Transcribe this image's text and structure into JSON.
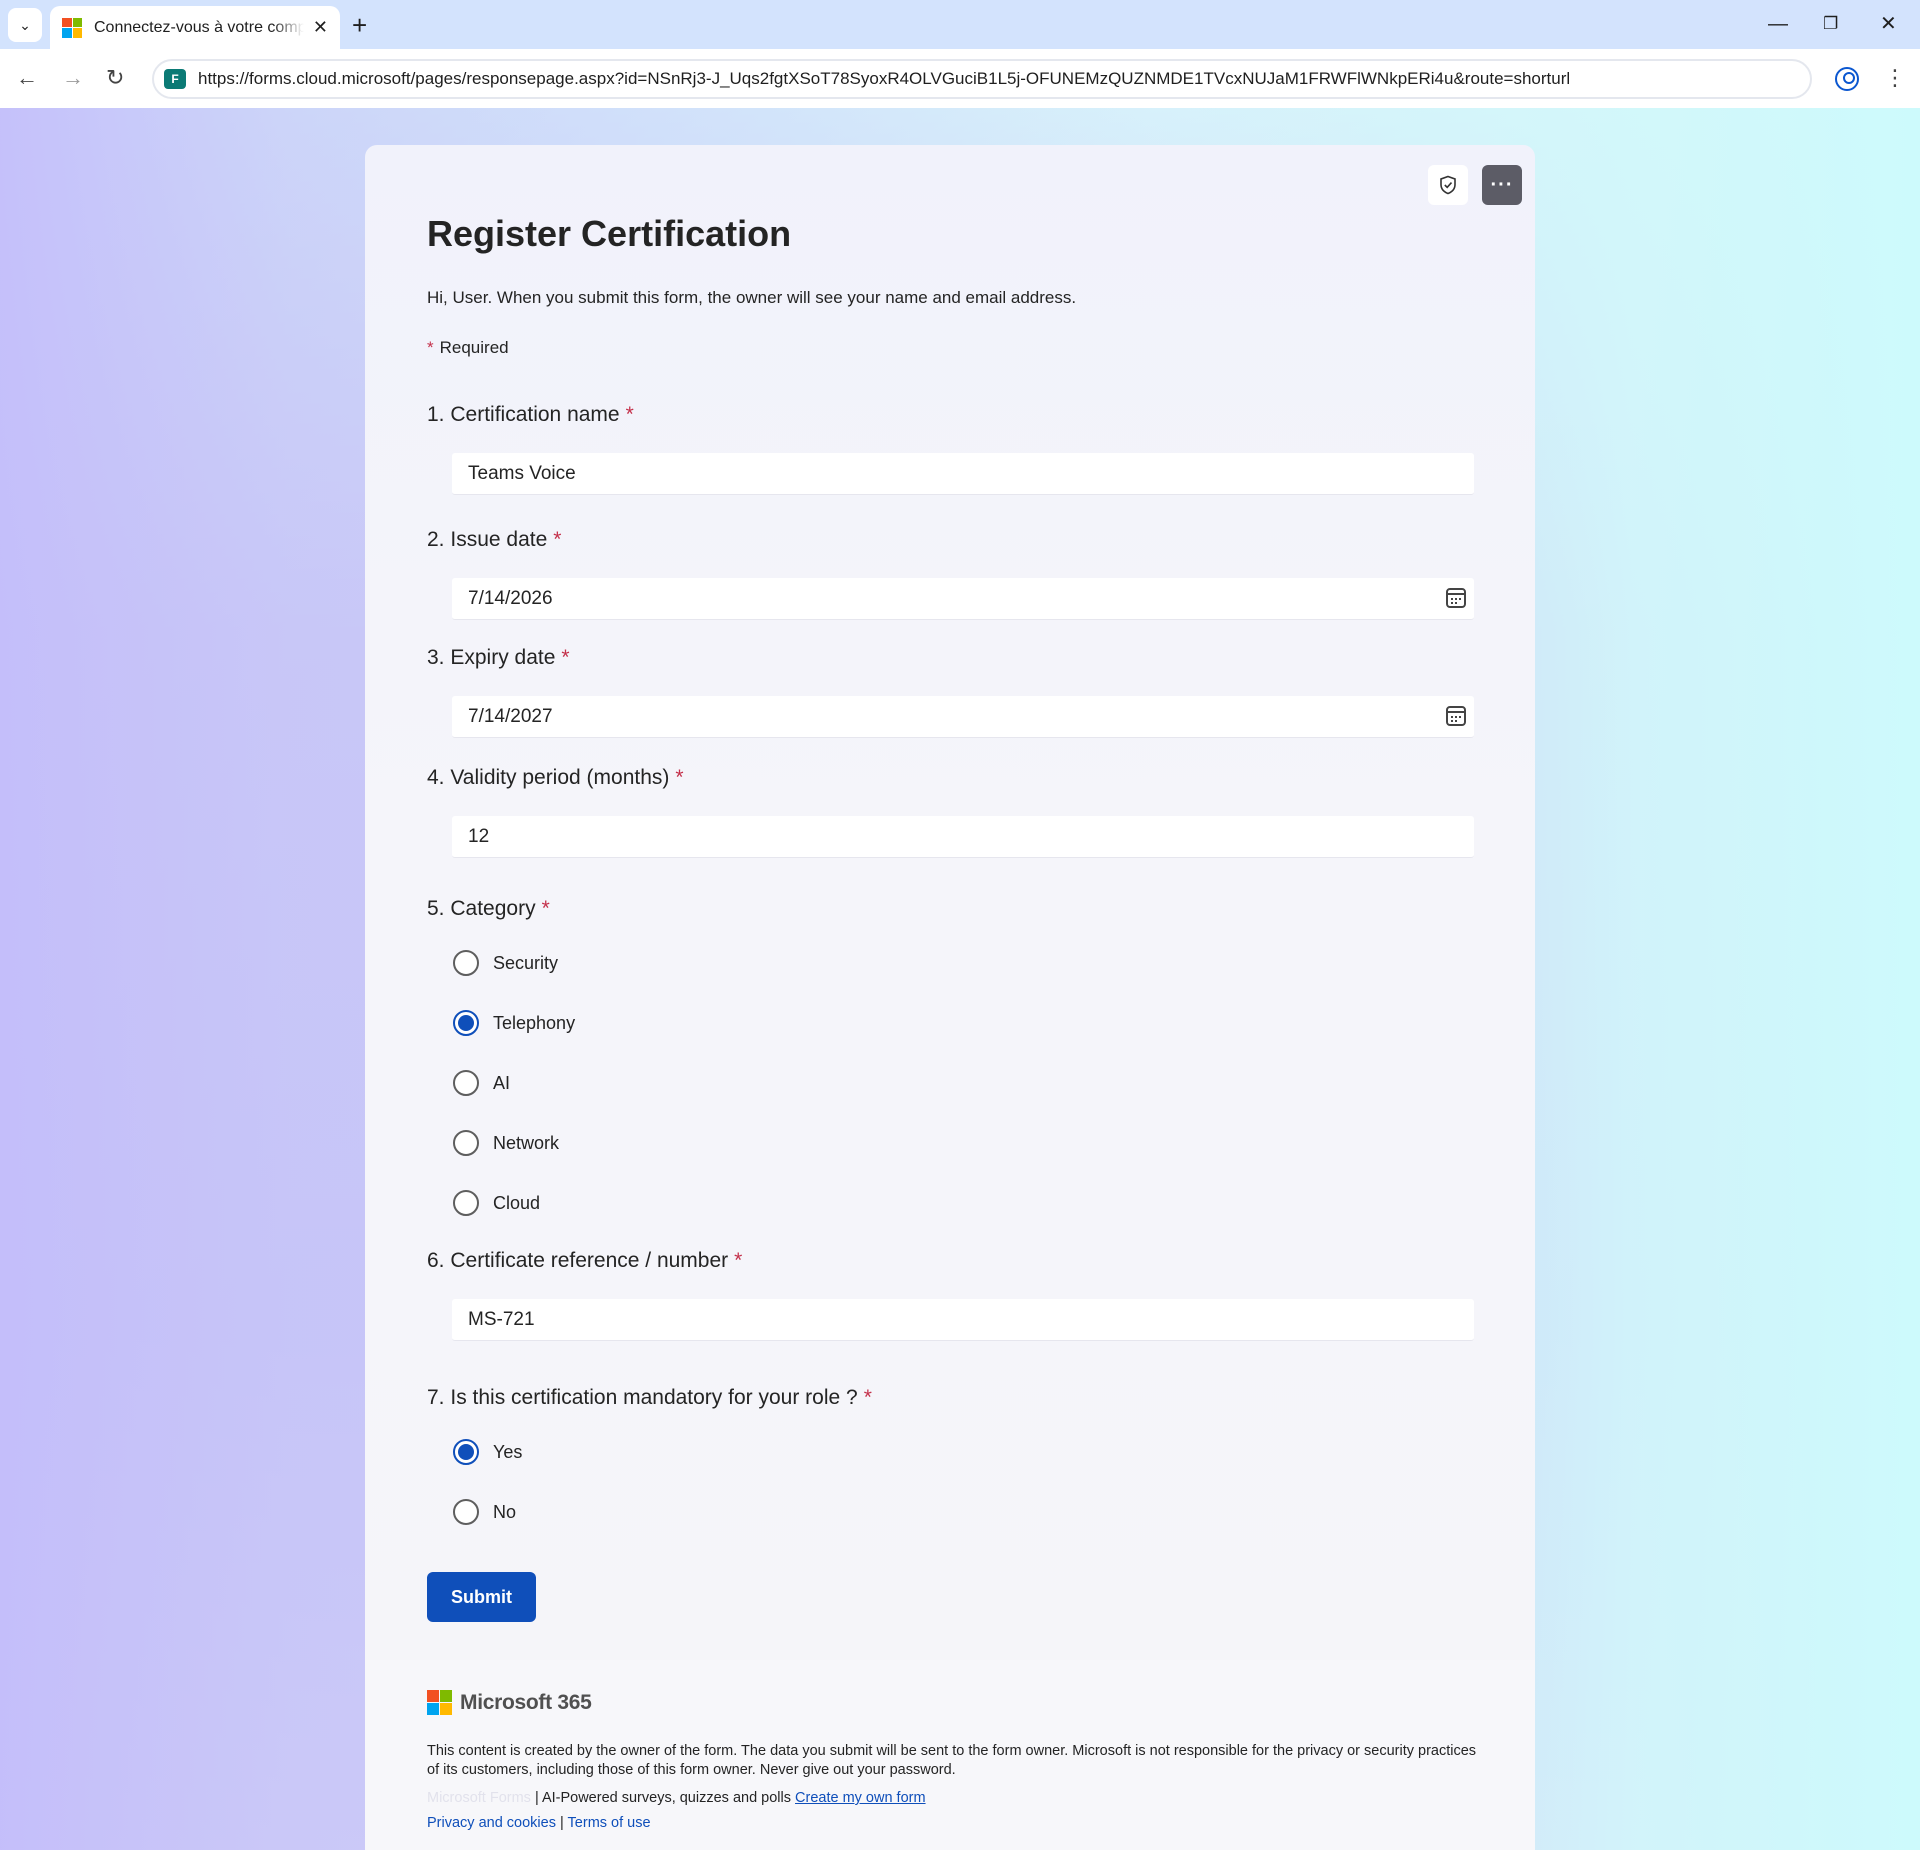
{
  "browser": {
    "tab_title": "Connectez-vous à votre compte",
    "url": "https://forms.cloud.microsoft/pages/responsepage.aspx?id=NSnRj3-J_Uqs2fgtXSoT78SyoxR4OLVGuciB1L5j-OFUNEMzQUZNMDE1TVcxNUJaM1FRWFlWNkpERi4u&route=shorturl"
  },
  "form": {
    "title": "Register Certification",
    "intro": "Hi, User. When you submit this form, the owner will see your name and email address.",
    "required_label": "Required",
    "required_mark": "*",
    "questions": [
      {
        "number": "1.",
        "title": "Certification name",
        "value": "Teams Voice"
      },
      {
        "number": "2.",
        "title": "Issue date",
        "value": "7/14/2026"
      },
      {
        "number": "3.",
        "title": "Expiry date",
        "value": "7/14/2027"
      },
      {
        "number": "4.",
        "title": "Validity period (months)",
        "value": "12"
      },
      {
        "number": "5.",
        "title": "Category",
        "options": [
          "Security",
          "Telephony",
          "AI",
          "Network",
          "Cloud"
        ],
        "selected": "Telephony"
      },
      {
        "number": "6.",
        "title": "Certificate reference / number",
        "value": "MS-721"
      },
      {
        "number": "7.",
        "title": "Is this certification mandatory for your role ?",
        "options": [
          "Yes",
          "No"
        ],
        "selected": "Yes"
      }
    ],
    "submit_label": "Submit"
  },
  "footer": {
    "brand": "Microsoft 365",
    "disclaimer": "This content is created by the owner of the form. The data you submit will be sent to the form owner. Microsoft is not responsible for the privacy or security practices of its customers, including those of this form owner. Never give out your password.",
    "forms_brand": "Microsoft Forms",
    "tagline": "| AI-Powered surveys, quizzes and polls",
    "create_link": "Create my own form",
    "privacy_link": "Privacy and cookies",
    "separator": "|",
    "terms_link": "Terms of use"
  },
  "colors": {
    "accent": "#0f4fba",
    "required": "#c4314b"
  },
  "icons": {
    "shield": "shield-icon",
    "more": "more-options-icon",
    "calendar": "calendar-icon"
  }
}
